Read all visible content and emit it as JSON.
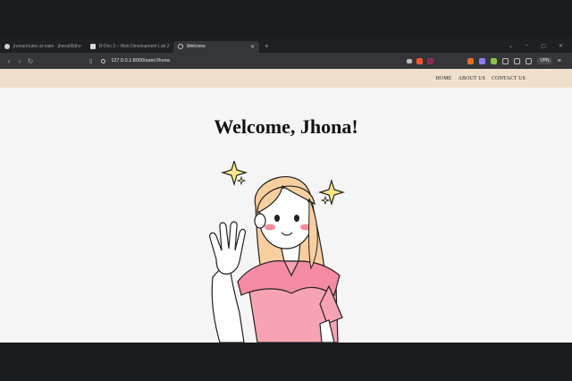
{
  "browser": {
    "tabs": [
      {
        "label": "jhona/routes at main · jhona06/jho",
        "active": false
      },
      {
        "label": "B-Dec 3 – Web Development Lab 2",
        "active": false
      },
      {
        "label": "Welcome",
        "active": true
      }
    ],
    "new_tab": "+",
    "url": "127.0.0.1:8000/user/Jhona",
    "vpn_label": "VPN",
    "colors": {
      "tabbar": "#1f2023",
      "toolbar": "#35363a",
      "brave": "#fb542b"
    }
  },
  "site": {
    "nav": [
      "HOME",
      "ABOUT US",
      "CONTACT US"
    ],
    "heading": "Welcome, Jhona!",
    "illustration": "waving-girl-illustration",
    "colors": {
      "nav_bg": "#efe0cb",
      "page_bg": "#f5f5f5",
      "shirt": "#f7a3b4",
      "hair": "#f9cfa0"
    }
  }
}
